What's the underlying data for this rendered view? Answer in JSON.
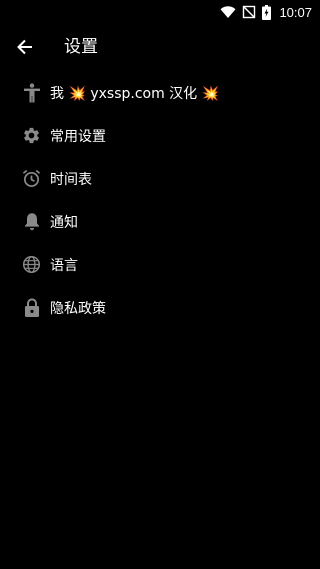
{
  "status_bar": {
    "time": "10:07",
    "icons": [
      "wifi-icon",
      "no-signal-icon",
      "battery-charging-icon"
    ]
  },
  "app_bar": {
    "back_icon": "arrow-left-icon",
    "title": "设置"
  },
  "menu": {
    "items": [
      {
        "icon": "accessibility-person-icon",
        "label": "我 💥 yxssp.com 汉化 💥"
      },
      {
        "icon": "gear-icon",
        "label": "常用设置"
      },
      {
        "icon": "alarm-clock-icon",
        "label": "时间表"
      },
      {
        "icon": "bell-icon",
        "label": "通知"
      },
      {
        "icon": "globe-icon",
        "label": "语言"
      },
      {
        "icon": "lock-icon",
        "label": "隐私政策"
      }
    ]
  },
  "colors": {
    "background": "#000000",
    "icon": "#8a8a8a",
    "text": "#ffffff"
  }
}
